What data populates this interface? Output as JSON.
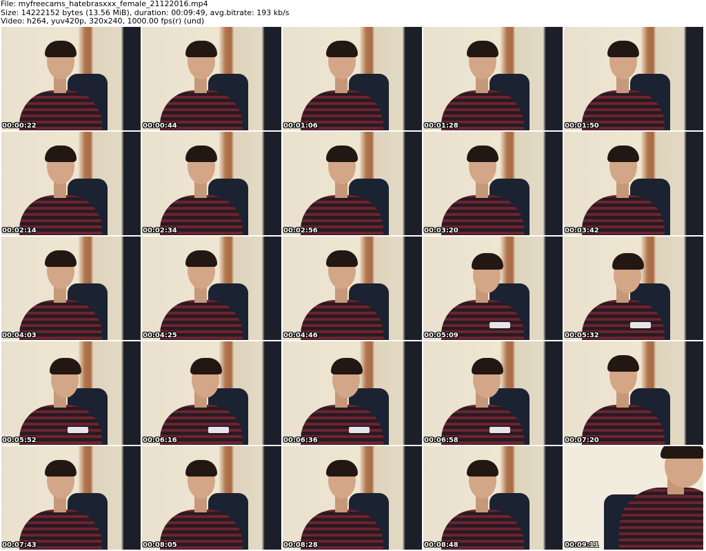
{
  "header": {
    "file_line": "File: myfreecams_hatebrasxxx_female_21122016.mp4",
    "size_line": "Size: 14222152 bytes (13.56 MiB), duration: 00:09:49, avg.bitrate: 193 kb/s",
    "video_line": "Video: h264, yuv420p, 320x240, 1000.00 fps(r) (und)"
  },
  "thumbnails": [
    {
      "timestamp": "00:00:22",
      "pose": "front"
    },
    {
      "timestamp": "00:00:44",
      "pose": "front"
    },
    {
      "timestamp": "00:01:06",
      "pose": "front"
    },
    {
      "timestamp": "00:01:28",
      "pose": "front"
    },
    {
      "timestamp": "00:01:50",
      "pose": "front"
    },
    {
      "timestamp": "00:02:14",
      "pose": "front"
    },
    {
      "timestamp": "00:02:34",
      "pose": "front"
    },
    {
      "timestamp": "00:02:56",
      "pose": "front"
    },
    {
      "timestamp": "00:03:20",
      "pose": "front"
    },
    {
      "timestamp": "00:03:42",
      "pose": "front"
    },
    {
      "timestamp": "00:04:03",
      "pose": "front"
    },
    {
      "timestamp": "00:04:25",
      "pose": "front"
    },
    {
      "timestamp": "00:04:46",
      "pose": "front"
    },
    {
      "timestamp": "00:05:09",
      "pose": "phone"
    },
    {
      "timestamp": "00:05:32",
      "pose": "phone"
    },
    {
      "timestamp": "00:05:52",
      "pose": "phone"
    },
    {
      "timestamp": "00:06:16",
      "pose": "phone"
    },
    {
      "timestamp": "00:06:36",
      "pose": "phone"
    },
    {
      "timestamp": "00:06:58",
      "pose": "phone"
    },
    {
      "timestamp": "00:07:20",
      "pose": "front"
    },
    {
      "timestamp": "00:07:43",
      "pose": "front"
    },
    {
      "timestamp": "00:08:05",
      "pose": "front"
    },
    {
      "timestamp": "00:08:28",
      "pose": "front"
    },
    {
      "timestamp": "00:08:48",
      "pose": "front"
    },
    {
      "timestamp": "00:09:11",
      "pose": "close"
    }
  ]
}
